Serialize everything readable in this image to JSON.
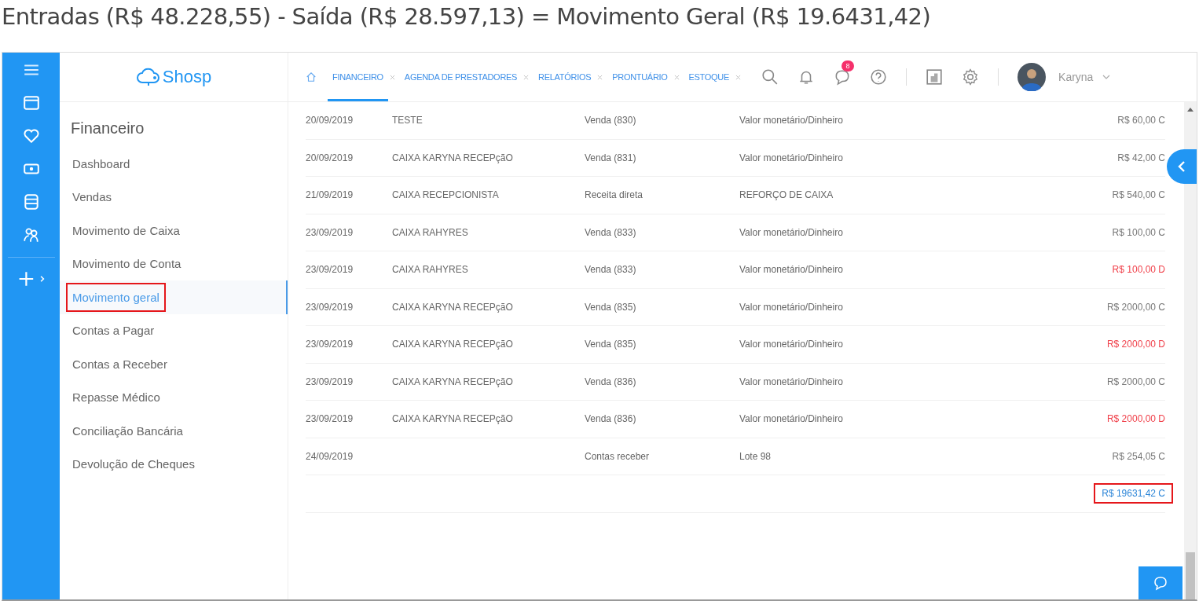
{
  "heading": "Entradas (R$ 48.228,55) - Saída (R$ 28.597,13) = Movimento Geral (R$ 19.6431,42)",
  "logo": {
    "text": "Shosp"
  },
  "sidebar": {
    "title": "Financeiro",
    "items": [
      {
        "label": "Dashboard",
        "selected": false,
        "highlighted": false
      },
      {
        "label": "Vendas",
        "selected": false,
        "highlighted": false
      },
      {
        "label": "Movimento de Caixa",
        "selected": false,
        "highlighted": false
      },
      {
        "label": "Movimento de Conta",
        "selected": false,
        "highlighted": false
      },
      {
        "label": "Movimento geral",
        "selected": true,
        "highlighted": true
      },
      {
        "label": "Contas a Pagar",
        "selected": false,
        "highlighted": false
      },
      {
        "label": "Contas a Receber",
        "selected": false,
        "highlighted": false
      },
      {
        "label": "Repasse Médico",
        "selected": false,
        "highlighted": false
      },
      {
        "label": "Conciliação Bancária",
        "selected": false,
        "highlighted": false
      },
      {
        "label": "Devolução de Cheques",
        "selected": false,
        "highlighted": false
      }
    ]
  },
  "tabs": [
    {
      "label": "FINANCEIRO",
      "selected": true
    },
    {
      "label": "AGENDA DE PRESTADORES",
      "selected": false
    },
    {
      "label": "RELATÓRIOS",
      "selected": false
    },
    {
      "label": "PRONTUÁRIO",
      "selected": false
    },
    {
      "label": "ESTOQUE",
      "selected": false
    }
  ],
  "toolbar": {
    "message_badge": "8",
    "user": "Karyna"
  },
  "table": {
    "rows": [
      {
        "kind": "credit",
        "date": "20/09/2019",
        "account": "TESTE",
        "type": "Venda (830)",
        "method": "Valor monetário/Dinheiro",
        "amount": "R$ 60,00 C"
      },
      {
        "kind": "credit",
        "date": "20/09/2019",
        "account": "CAIXA KARYNA RECEPçãO",
        "type": "Venda (831)",
        "method": "Valor monetário/Dinheiro",
        "amount": "R$ 42,00 C"
      },
      {
        "kind": "credit",
        "date": "21/09/2019",
        "account": "CAIXA RECEPCIONISTA",
        "type": "Receita direta",
        "method": "REFORÇO DE CAIXA",
        "amount": "R$ 540,00 C"
      },
      {
        "kind": "credit",
        "date": "23/09/2019",
        "account": "CAIXA RAHYRES",
        "type": "Venda (833)",
        "method": "Valor monetário/Dinheiro",
        "amount": "R$ 100,00 C"
      },
      {
        "kind": "debit",
        "date": "23/09/2019",
        "account": "CAIXA RAHYRES",
        "type": "Venda (833)",
        "method": "Valor monetário/Dinheiro",
        "amount": "R$ 100,00 D"
      },
      {
        "kind": "credit",
        "date": "23/09/2019",
        "account": "CAIXA KARYNA RECEPçãO",
        "type": "Venda (835)",
        "method": "Valor monetário/Dinheiro",
        "amount": "R$ 2000,00 C"
      },
      {
        "kind": "debit",
        "date": "23/09/2019",
        "account": "CAIXA KARYNA RECEPçãO",
        "type": "Venda (835)",
        "method": "Valor monetário/Dinheiro",
        "amount": "R$ 2000,00 D"
      },
      {
        "kind": "credit",
        "date": "23/09/2019",
        "account": "CAIXA KARYNA RECEPçãO",
        "type": "Venda (836)",
        "method": "Valor monetário/Dinheiro",
        "amount": "R$ 2000,00 C"
      },
      {
        "kind": "debit",
        "date": "23/09/2019",
        "account": "CAIXA KARYNA RECEPçãO",
        "type": "Venda (836)",
        "method": "Valor monetário/Dinheiro",
        "amount": "R$ 2000,00 D"
      },
      {
        "kind": "credit",
        "date": "24/09/2019",
        "type": "Contas receber",
        "method": "Lote 98",
        "amount": "R$ 254,05 C"
      }
    ],
    "total": {
      "amount": "R$ 19631,42 C",
      "highlighted": true
    }
  }
}
